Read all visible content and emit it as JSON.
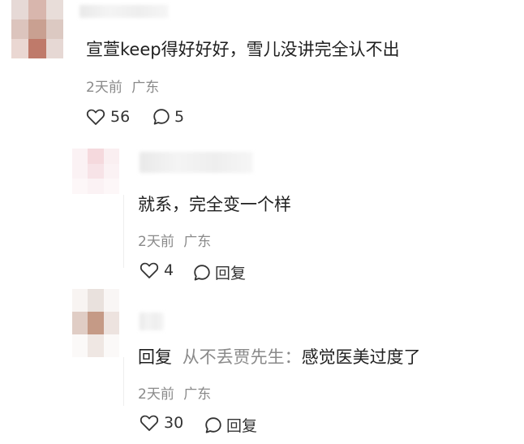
{
  "comments": [
    {
      "text": "宣萱keep得好好好，雪儿没讲完全认不出",
      "time": "2天前",
      "location": "广东",
      "likes": "56",
      "replies": "5"
    },
    {
      "text": "就系，完全变一个样",
      "time": "2天前",
      "location": "广东",
      "likes": "4",
      "reply_label": "回复"
    },
    {
      "reply_prefix": "回复",
      "reply_target": "从不丢贾先生：",
      "text": "感觉医美过度了",
      "time": "2天前",
      "location": "广东",
      "likes": "30",
      "reply_label": "回复"
    }
  ],
  "icons": {
    "like": "heart-outline-icon",
    "comment": "speech-bubble-icon"
  },
  "colors": {
    "primary_text": "#1f1f1f",
    "secondary_text": "#8a8a8a",
    "background": "#ffffff"
  }
}
